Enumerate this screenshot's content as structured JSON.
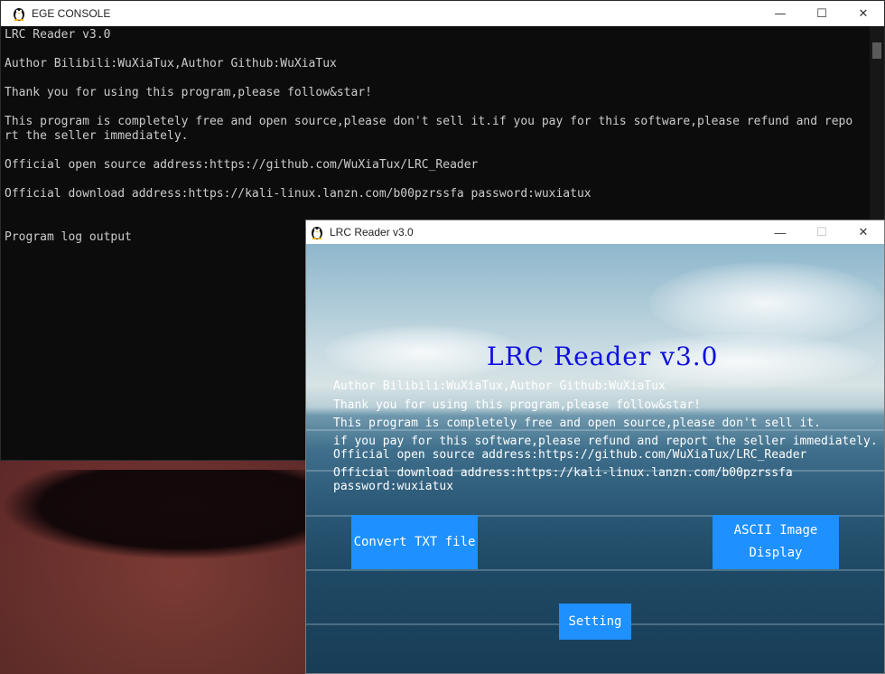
{
  "console": {
    "window_title": "EGE CONSOLE",
    "controls": {
      "minimize": "—",
      "maximize": "☐",
      "close": "✕"
    },
    "lines": [
      "LRC Reader v3.0",
      "",
      "Author Bilibili:WuXiaTux,Author Github:WuXiaTux",
      "",
      "Thank you for using this program,please follow&star!",
      "",
      "This program is completely free and open source,please don't sell it.if you pay for this software,please refund and repo",
      "rt the seller immediately.",
      "",
      "Official open source address:https://github.com/WuXiaTux/LRC_Reader",
      "",
      "Official download address:https://kali-linux.lanzn.com/b00pzrssfa password:wuxiatux",
      "",
      "",
      "Program log output"
    ]
  },
  "lrc_window": {
    "window_title": "LRC Reader v3.0",
    "controls": {
      "minimize": "—",
      "maximize": "☐",
      "close": "✕"
    },
    "title": "LRC Reader v3.0",
    "info": {
      "author": "Author Bilibili:WuXiaTux,Author Github:WuXiaTux",
      "thanks": "Thank you for using this program,please follow&star!",
      "free": "This program is completely free and open source,please don't sell it.",
      "refund": "if you pay for this software,please refund and report the seller immediately.",
      "source": "Official open source address:https://github.com/WuXiaTux/LRC_Reader",
      "download": "Official download address:https://kali-linux.lanzn.com/b00pzrssfa",
      "password": "password:wuxiatux"
    },
    "buttons": {
      "convert": "Convert TXT file",
      "ascii_line1": "ASCII Image",
      "ascii_line2": "Display",
      "setting": "Setting"
    },
    "colors": {
      "title": "#1010e0",
      "button": "#1e90ff",
      "text": "#ffffff"
    }
  }
}
